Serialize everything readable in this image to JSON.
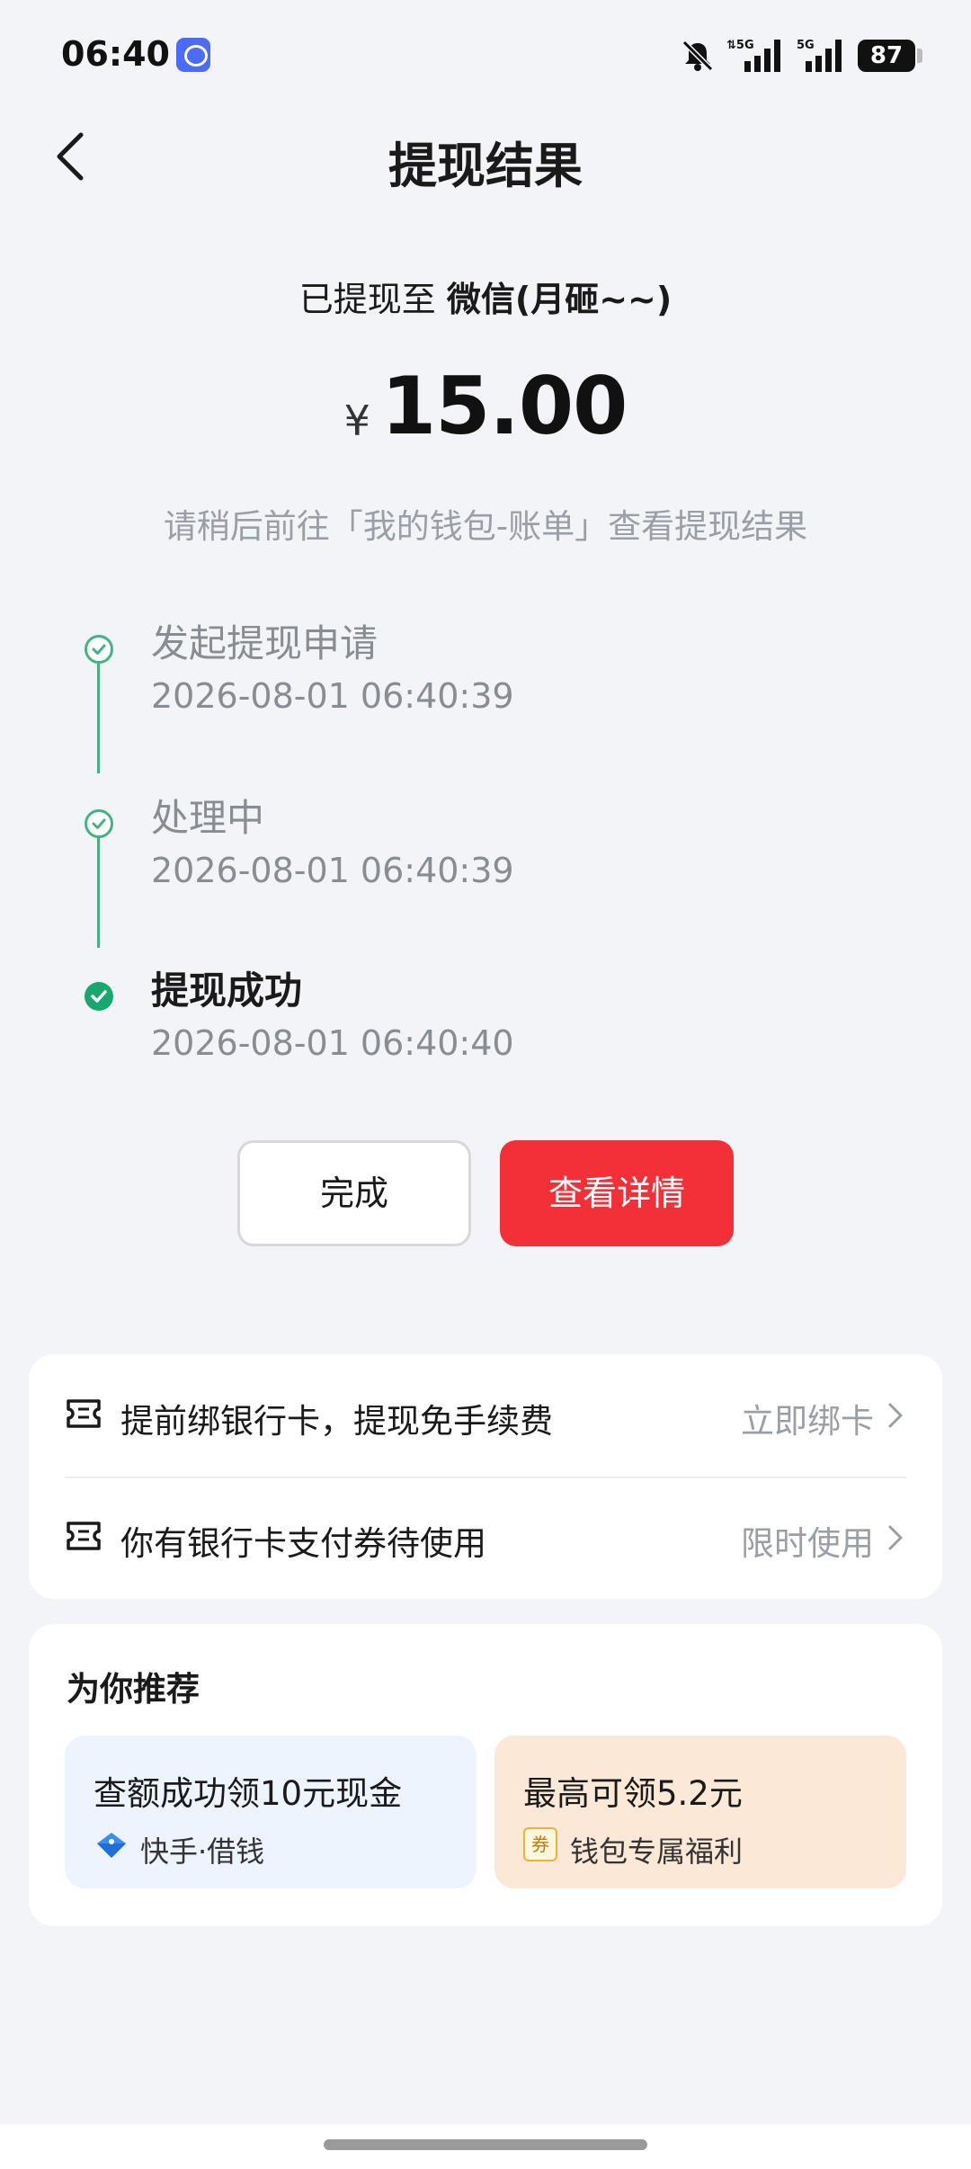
{
  "status_bar": {
    "time": "06:40",
    "battery": "87",
    "icons": [
      "app-icon",
      "mute-icon",
      "5g-signal-icon",
      "5g-signal-icon"
    ]
  },
  "nav": {
    "title": "提现结果",
    "back_icon": "chevron-left-icon"
  },
  "result": {
    "dest_prefix": "已提现至",
    "dest_account": "微信(月砸~~)",
    "currency": "¥",
    "amount": "15.00",
    "hint": "请稍后前往「我的钱包-账单」查看提现结果"
  },
  "timeline": [
    {
      "title": "发起提现申请",
      "time": "2026-08-01 06:40:39",
      "state": "done"
    },
    {
      "title": "处理中",
      "time": "2026-08-01 06:40:39",
      "state": "done"
    },
    {
      "title": "提现成功",
      "time": "2026-08-01 06:40:40",
      "state": "current"
    }
  ],
  "actions": {
    "done_label": "完成",
    "detail_label": "查看详情"
  },
  "promos": [
    {
      "text": "提前绑银行卡，提现免手续费",
      "action": "立即绑卡",
      "icon": "ticket-icon"
    },
    {
      "text": "你有银行卡支付券待使用",
      "action": "限时使用",
      "icon": "ticket-icon"
    }
  ],
  "recommend": {
    "title": "为你推荐",
    "tiles": [
      {
        "title": "查额成功领10元现金",
        "sub": "快手·借钱",
        "icon": "diamond-icon"
      },
      {
        "title": "最高可领5.2元",
        "sub": "钱包专属福利",
        "icon": "coupon-icon",
        "icon_text": "券"
      }
    ]
  },
  "colors": {
    "accent_red": "#f33038",
    "success_green": "#17a870",
    "background": "#f3f4f8"
  }
}
